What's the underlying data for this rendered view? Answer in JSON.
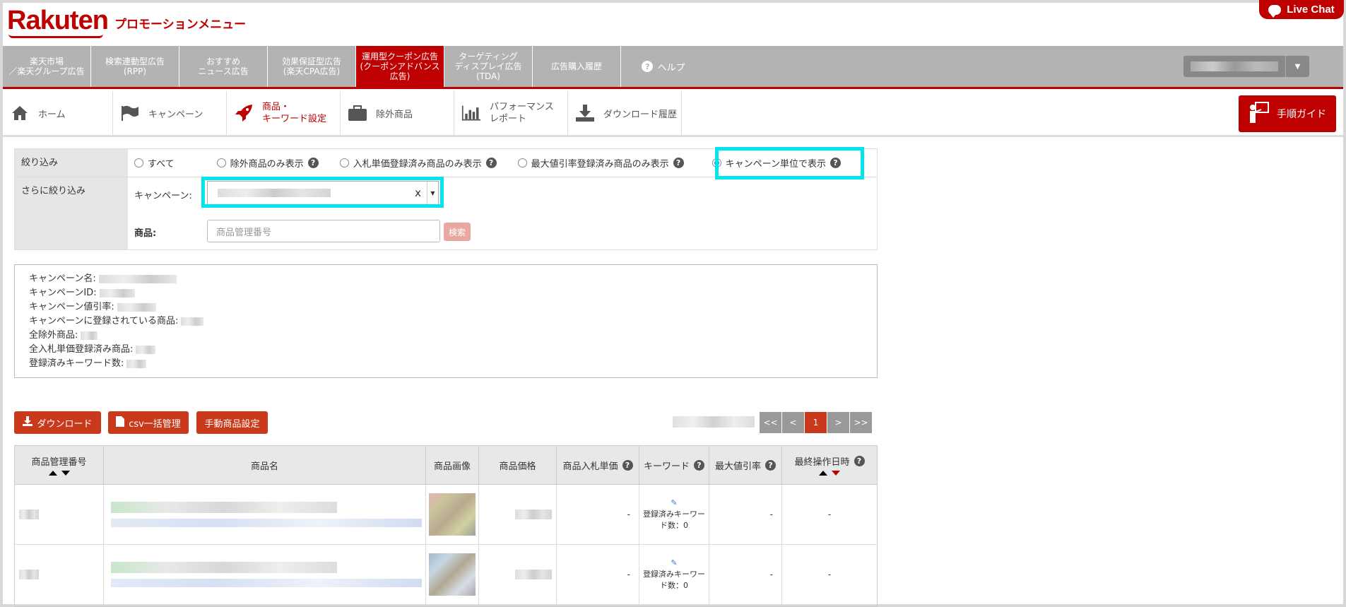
{
  "header": {
    "logo": "Rakuten",
    "title": "プロモーションメニュー",
    "live_chat": "Live Chat"
  },
  "topnav": {
    "items": [
      {
        "label": "楽天市場\n／楽天グループ広告"
      },
      {
        "label": "検索連動型広告\n(RPP)"
      },
      {
        "label": "おすすめ\nニュース広告"
      },
      {
        "label": "効果保証型広告\n(楽天CPA広告)"
      },
      {
        "label": "運用型クーポン広告\n(クーポンアドバンス\n広告)"
      },
      {
        "label": "ターゲティング\nディスプレイ広告\n(TDA)"
      },
      {
        "label": "広告購入履歴"
      }
    ],
    "help": "ヘルプ"
  },
  "subnav": {
    "items": [
      {
        "label": "ホーム",
        "icon": "home-icon"
      },
      {
        "label": "キャンペーン",
        "icon": "flag-icon"
      },
      {
        "label": "商品・\nキーワード設定",
        "icon": "rocket-icon"
      },
      {
        "label": "除外商品",
        "icon": "briefcase-icon"
      },
      {
        "label": "パフォーマンス\nレポート",
        "icon": "bar-chart-icon"
      },
      {
        "label": "ダウンロード履歴",
        "icon": "download-icon"
      }
    ],
    "guide": "手順ガイド"
  },
  "filter": {
    "label1": "絞り込み",
    "label2": "さらに絞り込み",
    "radios": [
      "すべて",
      "除外商品のみ表示",
      "入札単価登録済み商品のみ表示",
      "最大値引率登録済み商品のみ表示",
      "キャンペーン単位で表示"
    ],
    "selected": "キャンペーン単位で表示",
    "campaign_label": "キャンペーン:",
    "clear": "x",
    "product_label": "商品:",
    "product_placeholder": "商品管理番号",
    "search_btn": "検索"
  },
  "info": {
    "lines": [
      "キャンペーン名:",
      "キャンペーンID:",
      "キャンペーン値引率:",
      "キャンペーンに登録されている商品:",
      "全除外商品:",
      "全入札単価登録済み商品:",
      "登録済みキーワード数:"
    ]
  },
  "actions": {
    "download": "ダウンロード",
    "csv": "csv一括管理",
    "manual": "手動商品設定"
  },
  "pager": {
    "first": "<<",
    "prev": "<",
    "current": "1",
    "next": ">",
    "last": ">>"
  },
  "table": {
    "headers": [
      "商品管理番号",
      "商品名",
      "商品画像",
      "商品価格",
      "商品入札単価",
      "キーワード",
      "最大値引率",
      "最終操作日時"
    ],
    "rows": [
      {
        "bid": "-",
        "keyword": "登録済みキーワー\nド数：0",
        "discount": "-",
        "last": "-"
      },
      {
        "bid": "-",
        "keyword": "登録済みキーワー\nド数：0",
        "discount": "-",
        "last": "-"
      }
    ]
  },
  "colors": {
    "brand": "#bf0000",
    "highlight": "#00e5ee",
    "nav_gray": "#b3b3b3"
  }
}
